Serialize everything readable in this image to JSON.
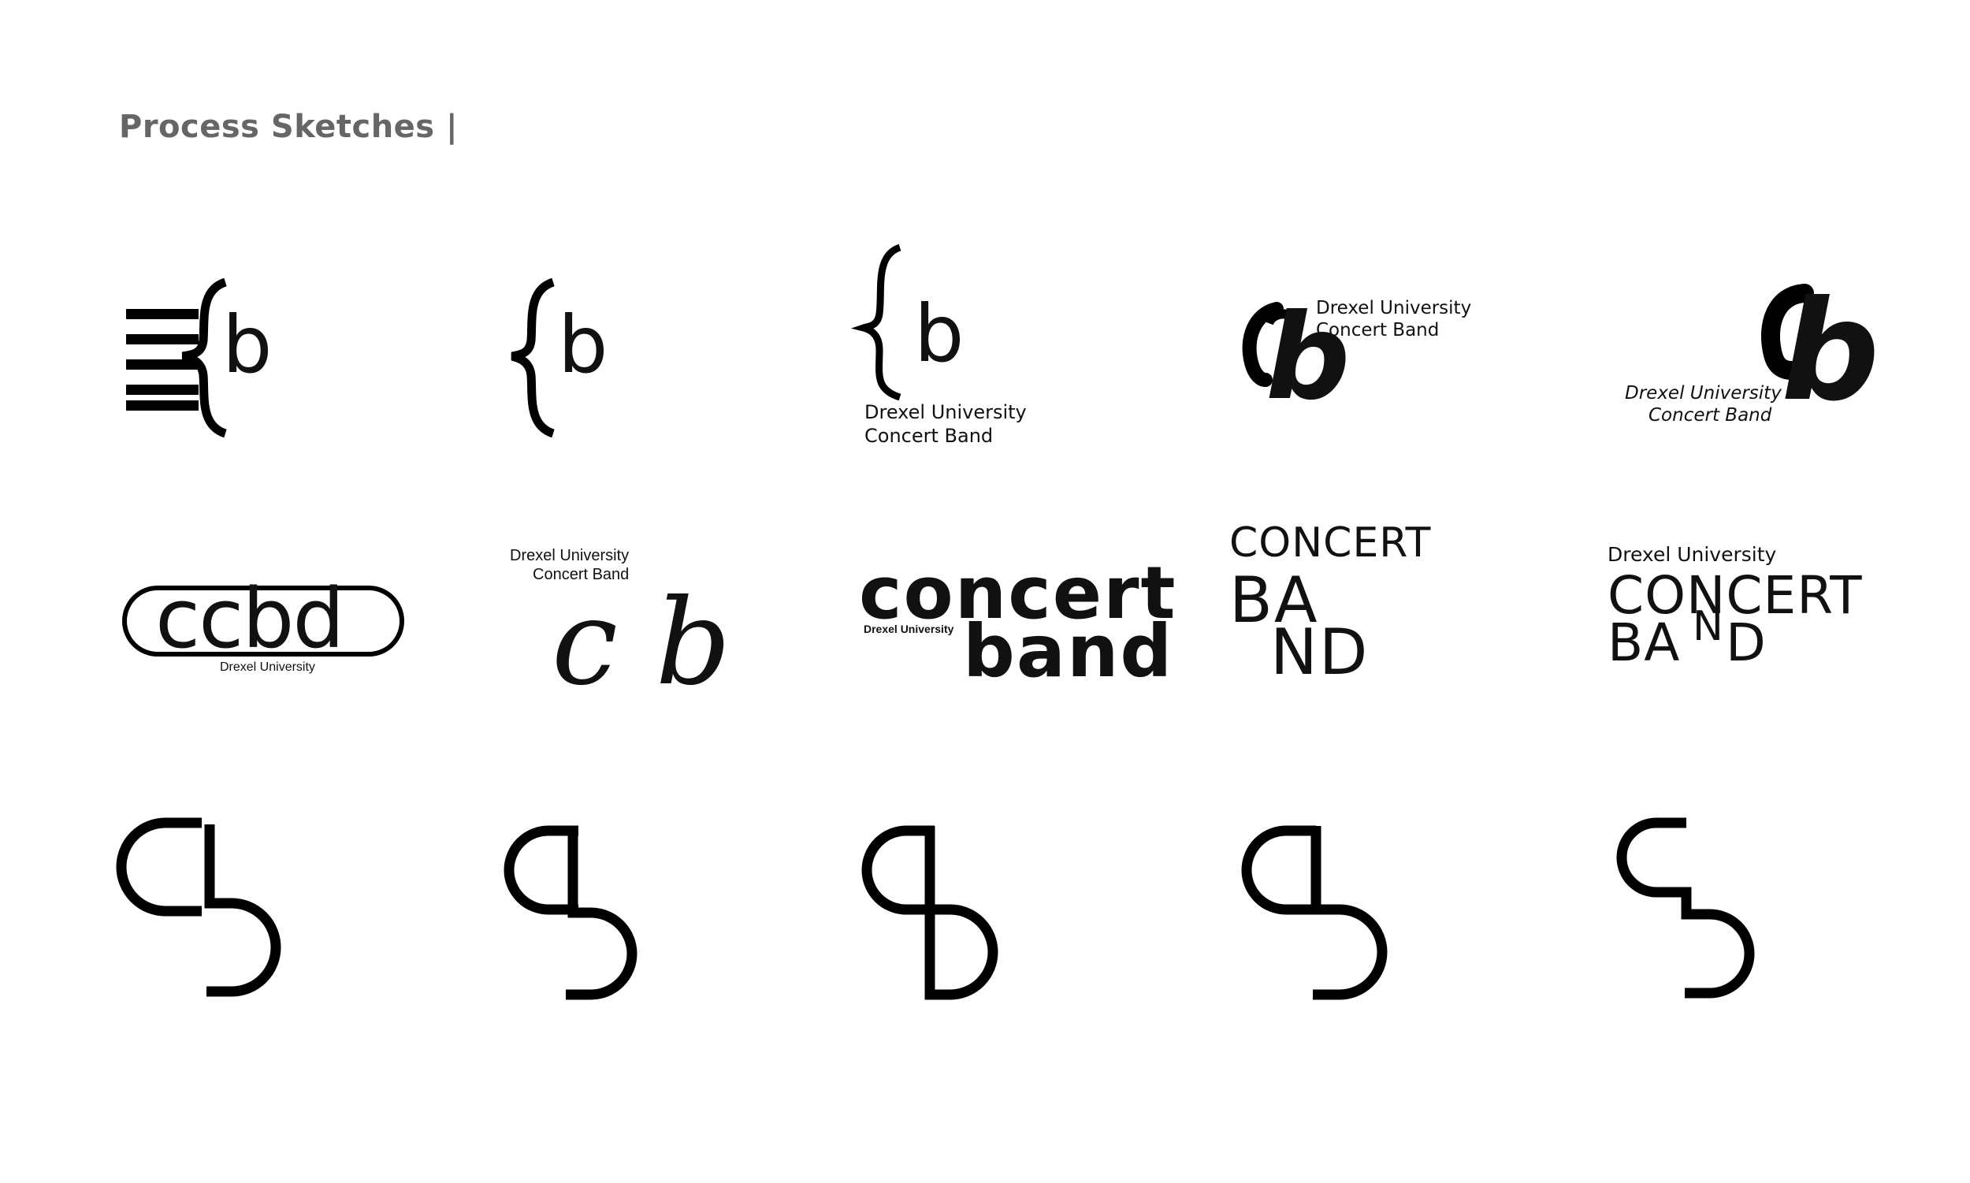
{
  "header": {
    "title": "Process Sketches |"
  },
  "sketches": {
    "s1": {
      "letter": "b"
    },
    "s2": {
      "letter": "b"
    },
    "s3": {
      "letter": "b",
      "line1": "Drexel University",
      "line2": "Concert Band"
    },
    "s4": {
      "letter": "b",
      "line1": "Drexel University",
      "line2": "Concert Band"
    },
    "s5": {
      "letter": "b",
      "line1": "Drexel University",
      "line2": "Concert Band"
    },
    "s6": {
      "word": "ccbd",
      "sub": "Drexel University"
    },
    "s7": {
      "line1": "Drexel University",
      "line2": "Concert Band",
      "letters": "c b"
    },
    "s8": {
      "word1": "concert",
      "word2": "band",
      "sub": "Drexel University"
    },
    "s9": {
      "word1": "CONCERT",
      "word2": "BA",
      "word3": "ND"
    },
    "s10": {
      "sub": "Drexel University",
      "word1": "CONCERT",
      "word2a": "BA",
      "word2b": "N",
      "word2c": "D"
    }
  }
}
